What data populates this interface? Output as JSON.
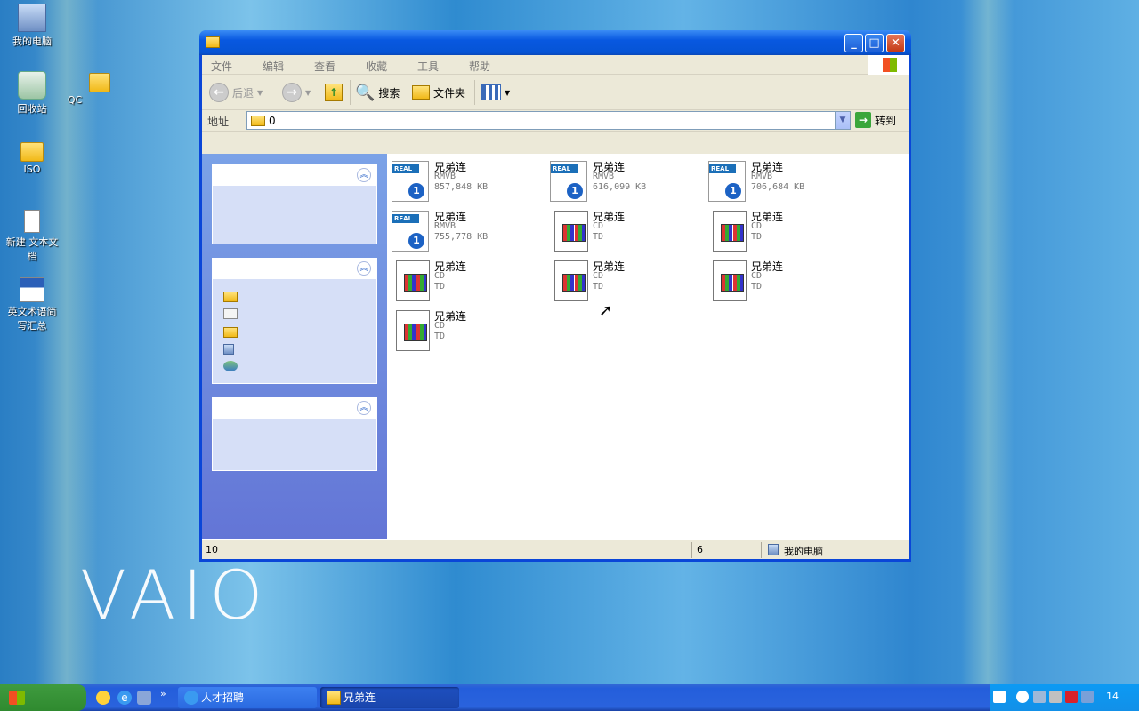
{
  "desktop": {
    "brand": "VAIO",
    "icons": [
      {
        "label": "我的电脑"
      },
      {
        "label": "回收站"
      },
      {
        "label": "QC"
      },
      {
        "label": "ISO"
      },
      {
        "label": "新建 文本文档"
      },
      {
        "label": "英文术语简写汇总"
      }
    ]
  },
  "window": {
    "menu": [
      "文件",
      "编辑",
      "查看",
      "收藏",
      "工具",
      "帮助"
    ],
    "toolbar": {
      "back": "后退",
      "search": "搜索",
      "folders": "文件夹"
    },
    "address": {
      "label": "地址",
      "value": "0",
      "go": "转到"
    },
    "files": [
      {
        "name": "兄弟连",
        "type": "RMVB",
        "size": "857,848 KB",
        "kind": "real"
      },
      {
        "name": "兄弟连",
        "type": "RMVB",
        "size": "616,099 KB",
        "kind": "real"
      },
      {
        "name": "兄弟连",
        "type": "RMVB",
        "size": "706,684 KB",
        "kind": "real"
      },
      {
        "name": "兄弟连",
        "type": "RMVB",
        "size": "755,778 KB",
        "kind": "real"
      },
      {
        "name": "兄弟连",
        "type": "CD",
        "size": "TD",
        "kind": "cd"
      },
      {
        "name": "兄弟连",
        "type": "CD",
        "size": "TD",
        "kind": "cd"
      },
      {
        "name": "兄弟连",
        "type": "CD",
        "size": "TD",
        "kind": "cd"
      },
      {
        "name": "兄弟连",
        "type": "CD",
        "size": "TD",
        "kind": "cd"
      },
      {
        "name": "兄弟连",
        "type": "CD",
        "size": "TD",
        "kind": "cd"
      },
      {
        "name": "兄弟连",
        "type": "CD",
        "size": "TD",
        "kind": "cd"
      }
    ],
    "status": {
      "count": "10",
      "middle": "6",
      "location": "我的电脑"
    }
  },
  "taskbar": {
    "buttons": [
      "人才招聘",
      "兄弟连"
    ],
    "clock": "14"
  }
}
